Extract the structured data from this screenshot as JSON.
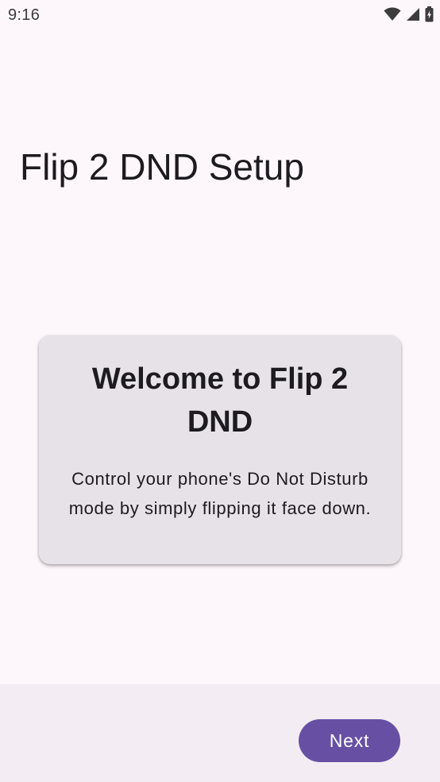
{
  "status_bar": {
    "time": "9:16",
    "icons": [
      "wifi-icon",
      "cell-signal-icon",
      "battery-charging-icon"
    ]
  },
  "setup": {
    "title": "Flip 2 DND Setup"
  },
  "welcome_card": {
    "title": "Welcome to Flip 2 DND",
    "body": "Control your phone's Do Not Disturb mode by simply flipping it face down."
  },
  "navigation": {
    "next_label": "Next"
  },
  "colors": {
    "background": "#fdf7fc",
    "card": "#e7e2e8",
    "bottom_bar": "#f3edf3",
    "primary": "#6750a4",
    "on_primary": "#ffffff",
    "text": "#1d1b20"
  }
}
